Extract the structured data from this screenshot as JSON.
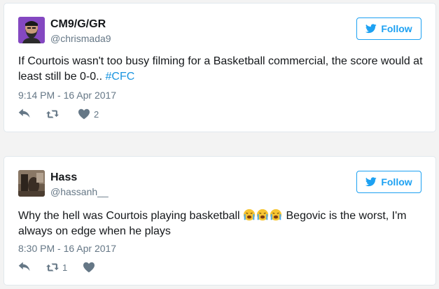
{
  "tweets": [
    {
      "name": "CM9/G/GR",
      "handle": "@chrismada9",
      "follow_label": "Follow",
      "text_before": "If Courtois wasn't too busy filming for a Basketball commercial, the score would at least still be 0-0.. ",
      "hashtag": "#CFC",
      "timestamp": "9:14 PM - 16 Apr 2017",
      "retweet_count": "",
      "like_count": "2",
      "avatar_icon": "bearded-man-avatar"
    },
    {
      "name": "Hass",
      "handle": "@hassanh__",
      "follow_label": "Follow",
      "text_before": "Why the hell was Courtois playing basketball ",
      "text_after": " Begovic is the worst, I'm always on edge when he plays",
      "emojis": [
        "loudly-crying-face",
        "loudly-crying-face",
        "loudly-crying-face"
      ],
      "timestamp": "8:30 PM - 16 Apr 2017",
      "retweet_count": "1",
      "like_count": "",
      "avatar_icon": "dark-room-avatar"
    }
  ],
  "colors": {
    "accent": "#1da1f2",
    "hashtag": "#1b95e0",
    "muted": "#657786"
  }
}
